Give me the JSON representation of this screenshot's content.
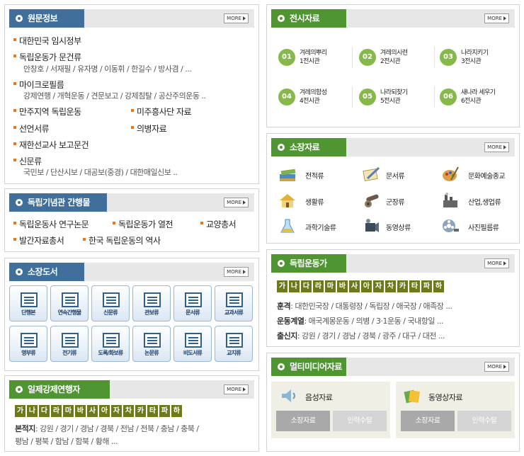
{
  "more_label": "MORE",
  "wonmun": {
    "title": "원문정보",
    "items": [
      {
        "label": "대한민국 임시정부",
        "sub": ""
      },
      {
        "label": "독립운동가 문건류",
        "sub": "안창호 / 서재필 / 유자명 / 이동휘 / 한길수 / 방사겸 / ..."
      },
      {
        "label": "마이크로필름",
        "sub": "강제연행 / 개혁운동 / 견문보고 / 강제침탈 / 공산주의운동 .."
      },
      {
        "label": "만주지역 독립운동",
        "sub": ""
      },
      {
        "label": "미주흥사단 자료",
        "sub": ""
      },
      {
        "label": "선언서류",
        "sub": ""
      },
      {
        "label": "의병자료",
        "sub": ""
      },
      {
        "label": "재한선교사 보고문건",
        "sub": ""
      },
      {
        "label": "신문류",
        "sub": "국민보 / 단산시보 / 대공보(중경) / 대한매일신보 .."
      }
    ]
  },
  "publications": {
    "title": "독립기념관 간행물",
    "items": [
      "독립운동사 연구논문",
      "독립운동가 열전",
      "교양총서",
      "발간자료총서",
      "한국 독립운동의 역사"
    ]
  },
  "library": {
    "title": "소장도서",
    "buttons": [
      "단행본",
      "연속간행물",
      "신문류",
      "관보류",
      "문서류",
      "교과서류",
      "명부류",
      "전기류",
      "도록/화보류",
      "논문류",
      "비도서류",
      "교지류"
    ]
  },
  "forced": {
    "title": "일제강제연행자",
    "index": [
      "가",
      "나",
      "다",
      "라",
      "마",
      "바",
      "사",
      "아",
      "자",
      "차",
      "카",
      "타",
      "파",
      "하"
    ],
    "label": "본적지",
    "value_line1": ": 강원 / 경기 / 경남 / 경북 / 전남 / 전북 / 충남 / 충북 /",
    "value_line2": "평남 / 평북 / 함남 / 함북 / 황해 ..."
  },
  "exhibit": {
    "title": "전시자료",
    "halls": [
      {
        "num": "01",
        "name": "겨레의뿌리",
        "hall": "1전시관"
      },
      {
        "num": "02",
        "name": "겨레의시련",
        "hall": "2전시관"
      },
      {
        "num": "03",
        "name": "나라지키기",
        "hall": "3전시관"
      },
      {
        "num": "04",
        "name": "겨레의함성",
        "hall": "4전시관"
      },
      {
        "num": "05",
        "name": "나라되찾기",
        "hall": "5전시관"
      },
      {
        "num": "06",
        "name": "새나라 세우기",
        "hall": "6전시관"
      }
    ]
  },
  "collection": {
    "title": "소장자료",
    "categories": [
      {
        "label": "전적류",
        "icon": "books-icon"
      },
      {
        "label": "문서류",
        "icon": "document-pen-icon"
      },
      {
        "label": "문화예술종교",
        "icon": "palette-icon"
      },
      {
        "label": "생활류",
        "icon": "house-icon"
      },
      {
        "label": "군장류",
        "icon": "cannon-icon"
      },
      {
        "label": "산업,생업류",
        "icon": "factory-icon"
      },
      {
        "label": "과학기술류",
        "icon": "flask-icon"
      },
      {
        "label": "동영상류",
        "icon": "film-camera-icon"
      },
      {
        "label": "사진필름류",
        "icon": "film-reel-icon"
      }
    ]
  },
  "activists": {
    "title": "독립운동가",
    "index": [
      "가",
      "나",
      "다",
      "라",
      "마",
      "바",
      "사",
      "아",
      "자",
      "차",
      "카",
      "타",
      "파",
      "하"
    ],
    "rows": [
      {
        "label": "훈격",
        "value": ": 대한민국장 / 대통령장 / 독립장 / 애국장 / 애족장 ..."
      },
      {
        "label": "운동계열",
        "value": ": 애국계몽운동 / 의병 / 3·1운동 / 국내항일 ..."
      },
      {
        "label": "출신지",
        "value": ": 강원 / 경기 / 경남 / 경북 / 광주 / 대구 / 대전 ..."
      }
    ]
  },
  "multimedia": {
    "title": "멀티미디어자료",
    "boxes": [
      {
        "title": "음성자료",
        "btn_on": "소장자료",
        "btn_off": "인력수탈"
      },
      {
        "title": "동영상자료",
        "btn_on": "소장자료",
        "btn_off": "인력수탈"
      }
    ]
  }
}
